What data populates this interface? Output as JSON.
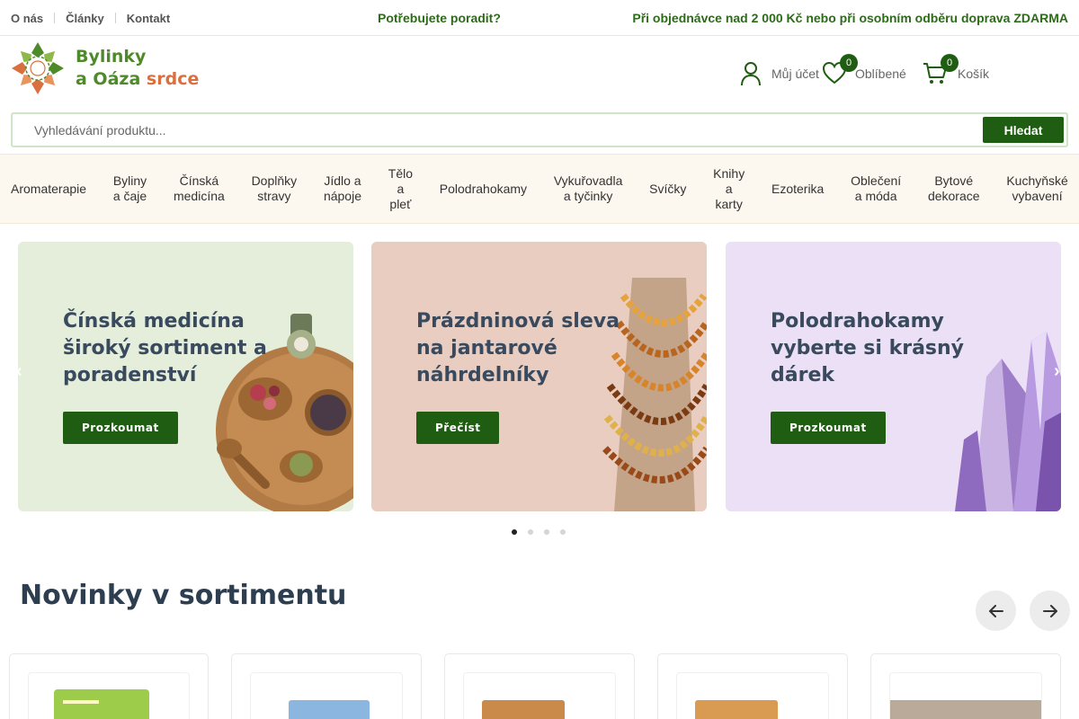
{
  "topbar": {
    "links": [
      "O nás",
      "Články",
      "Kontakt"
    ],
    "advice": "Potřebujete poradit?",
    "shipping": "Při objednávce nad 2 000 Kč nebo při osobním odběru doprava ZDARMA"
  },
  "logo": {
    "line1": "Bylinky",
    "line2a": "a Oáza",
    "line2b": "srdce"
  },
  "header": {
    "account_label": "Můj účet",
    "favorites_label": "Oblíbené",
    "favorites_count": "0",
    "cart_label": "Košík",
    "cart_count": "0"
  },
  "search": {
    "placeholder": "Vyhledávání produktu...",
    "button": "Hledat"
  },
  "categories": [
    "Aromaterapie",
    "Byliny\na čaje",
    "Čínská\nmedicína",
    "Doplňky\nstravy",
    "Jídlo a\nnápoje",
    "Tělo\na\npleť",
    "Polodrahokamy",
    "Vykuřovadla\na tyčinky",
    "Svíčky",
    "Knihy\na\nkarty",
    "Ezoterika",
    "Oblečení\na móda",
    "Bytové\ndekorace",
    "Kuchyňské\nvybavení"
  ],
  "slides": [
    {
      "title": "Čínská medicína široký sortiment a poradenství",
      "button": "Prozkoumat"
    },
    {
      "title": "Prázdninová sleva na jantarové náhrdelníky",
      "button": "Přečíst"
    },
    {
      "title": "Polodrahokamy vyberte si krásný dárek",
      "button": "Prozkoumat"
    }
  ],
  "slider_dots": {
    "count": 4,
    "active": 0
  },
  "section": {
    "title": "Novinky v sortimentu"
  },
  "colors": {
    "brand_green": "#1f5e12",
    "text_green": "#2d6a1a",
    "nav_bg": "#fcf8ef",
    "slide1_bg": "#e4eedb",
    "slide2_bg": "#e8cdc0",
    "slide3_bg": "#ece0f6"
  }
}
